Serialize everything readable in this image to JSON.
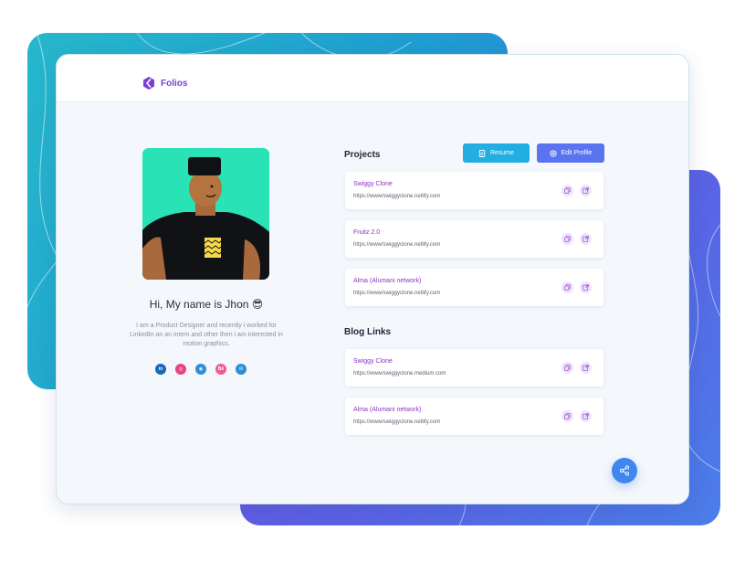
{
  "brand": {
    "name": "Folios",
    "icon": "folios-logo-icon"
  },
  "profile": {
    "greeting": "Hi, My name is Jhon",
    "emoji": "😎",
    "bio": "I am a Product Designer and recently i worked for LinkedIn an an intern and other then i am interested in motion graphics.",
    "socials": [
      {
        "icon": "linkedin-icon",
        "glyph": "in",
        "color": "#1769b7"
      },
      {
        "icon": "dribbble-icon",
        "glyph": "◎",
        "color": "#e8457e"
      },
      {
        "icon": "github-icon",
        "glyph": "◉",
        "color": "#2f8ed8"
      },
      {
        "icon": "behance-icon",
        "glyph": "Bē",
        "color": "#ef5b8c"
      },
      {
        "icon": "mail-icon",
        "glyph": "✉",
        "color": "#2f8ed8"
      }
    ]
  },
  "buttons": {
    "resume": "Resume",
    "edit_profile": "Edit Profile"
  },
  "projects": {
    "title": "Projects",
    "items": [
      {
        "name": "Swiggy Clone",
        "url": "https://www/swiggyclone.netlify.com"
      },
      {
        "name": "Fruitz 2.0",
        "url": "https://www/swiggyclone.netlify.com"
      },
      {
        "name": "Alma (Alumani network)",
        "url": "https://www/swiggyclone.netlify.com"
      }
    ]
  },
  "blog": {
    "title": "Blog Links",
    "items": [
      {
        "name": "Swiggy Clone",
        "url": "https://www/swiggyclone.medium.com"
      },
      {
        "name": "Alma (Alumani network)",
        "url": "https://www/swiggyclone.netlify.com"
      }
    ]
  },
  "colors": {
    "brand": "#7b3fd4",
    "resume_button": "#22aee0",
    "edit_button": "#5a74f0",
    "share_button": "#3f86ee",
    "avatar_bg": "#29e3b7"
  }
}
